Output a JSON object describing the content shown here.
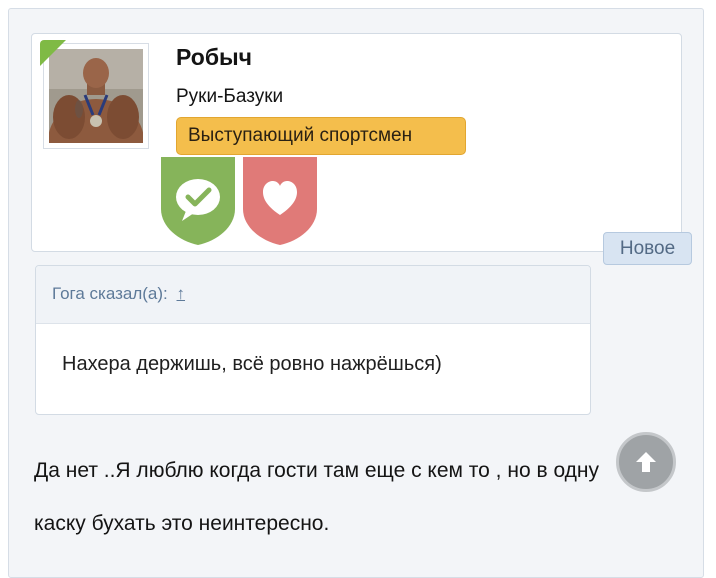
{
  "post": {
    "username": "Робыч",
    "user_title": "Руки-Базуки",
    "user_banner": "Выступающий спортсмен",
    "new_label": "Новое",
    "message": "Да нет ..Я люблю когда гости там еще с кем то , но в одну каску бухать это неинтересно."
  },
  "quote": {
    "attribution": "Гога сказал(а):",
    "jump_icon": "↑",
    "text": "Нахера держишь, всё ровно нажрёшься)"
  },
  "badges": [
    {
      "icon": "chat-check-icon",
      "color": "#86b45a"
    },
    {
      "icon": "heart-icon",
      "color": "#e07a78"
    }
  ],
  "colors": {
    "online": "#7fba45",
    "banner": "#f4be4c",
    "new_tag": "#d8e4f2",
    "scroll_button": "#9fa3a6"
  }
}
